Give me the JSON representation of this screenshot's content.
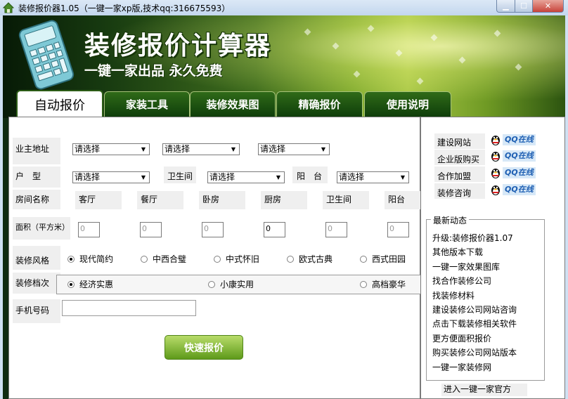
{
  "window": {
    "title": "装修报价器1.05（一键一家xp版,技术qq:316675593）"
  },
  "banner": {
    "title": "装修报价计算器",
    "subtitle": "一键一家出品 永久免费"
  },
  "tabs": [
    {
      "label": "自动报价",
      "active": true
    },
    {
      "label": "家装工具"
    },
    {
      "label": "装修效果图"
    },
    {
      "label": "精确报价"
    },
    {
      "label": "使用说明"
    }
  ],
  "form": {
    "address_label": "业主地址",
    "address_selects": [
      "请选择",
      "请选择",
      "请选择"
    ],
    "house_label": "户　型",
    "house_select": "请选择",
    "bathroom_label": "卫生间",
    "bathroom_select": "请选择",
    "balcony_label": "阳　台",
    "balcony_select": "请选择",
    "room_label": "房间名称",
    "rooms": [
      "客厅",
      "餐厅",
      "卧房",
      "厨房",
      "卫生间",
      "阳台"
    ],
    "area_label": "面积（平方米）",
    "areas": [
      "0",
      "0",
      "0",
      "0",
      "0",
      "0"
    ],
    "style_label": "装修风格",
    "styles": [
      {
        "label": "现代简约",
        "checked": true
      },
      {
        "label": "中西合璧",
        "checked": false
      },
      {
        "label": "中式怀旧",
        "checked": false
      },
      {
        "label": "欧式古典",
        "checked": false
      },
      {
        "label": "西式田园",
        "checked": false
      }
    ],
    "grade_label": "装修档次",
    "grades": [
      {
        "label": "经济实惠",
        "checked": true
      },
      {
        "label": "小康实用",
        "checked": false
      },
      {
        "label": "高档豪华",
        "checked": false
      }
    ],
    "phone_label": "手机号码",
    "phone_value": "",
    "submit_label": "快速报价"
  },
  "sidebar": {
    "contacts": [
      {
        "label": "建设网站",
        "qq": "QQ在线"
      },
      {
        "label": "企业版购买",
        "qq": "QQ在线"
      },
      {
        "label": "合作加盟",
        "qq": "QQ在线"
      },
      {
        "label": "装修咨询",
        "qq": "QQ在线"
      }
    ],
    "news_title": "最新动态",
    "news": [
      "升级:装修报价器1.07",
      "其他版本下载",
      "一键一家效果图库",
      "找合作装修公司",
      "找装修材料",
      "建设装修公司网站咨询",
      "点击下载装修相关软件",
      "更方便面积报价",
      "购买装修公司网站版本",
      "一键一家装修网"
    ],
    "official_link": "进入一键一家官方"
  },
  "colors": {
    "banner_green": "#3f6d1d",
    "tab_green": "#1f5a12",
    "qq_blue": "#1e5fb3",
    "button_green": "#7cb52f"
  }
}
